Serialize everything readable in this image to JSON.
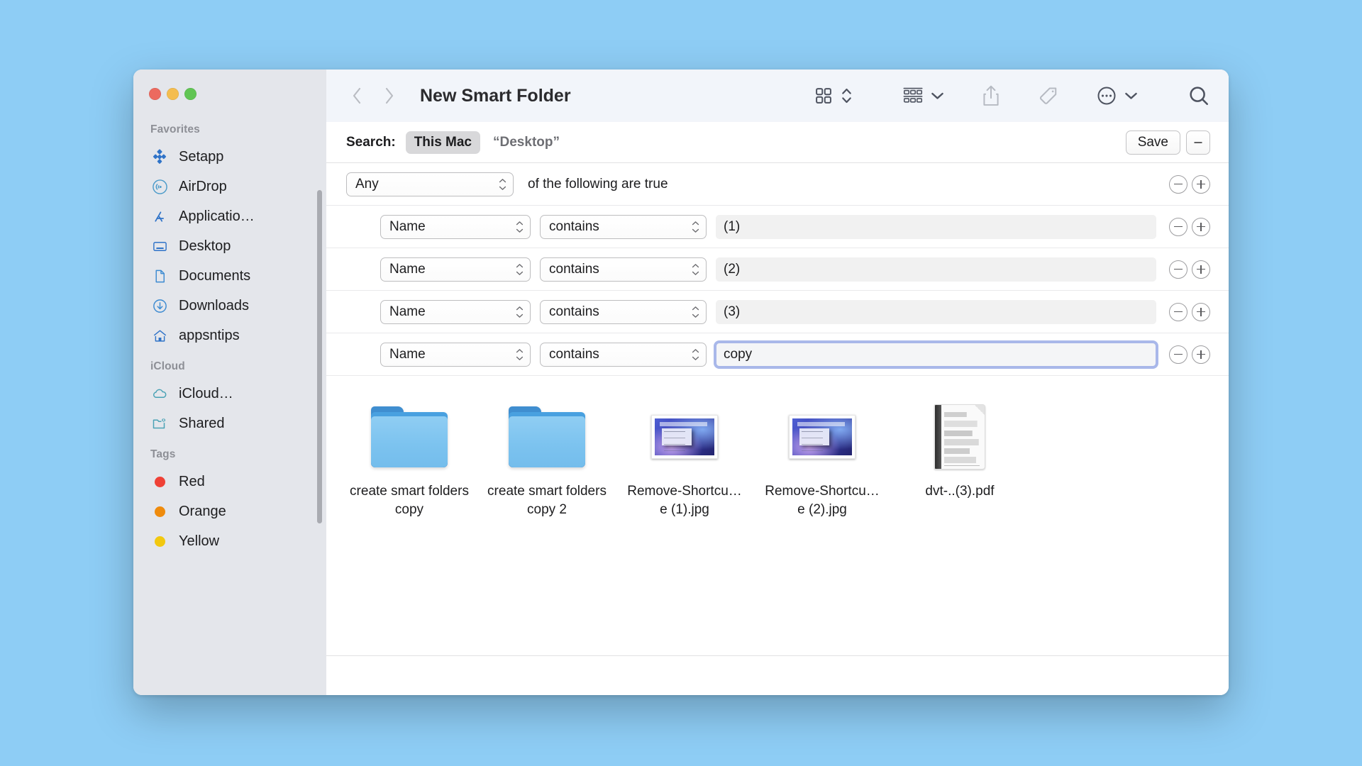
{
  "window": {
    "title": "New Smart Folder",
    "traffic_lights": [
      "close-red",
      "minimize-yellow",
      "maximize-green"
    ]
  },
  "toolbar": {
    "back_icon": "chevron-left-icon",
    "forward_icon": "chevron-right-icon",
    "view_icon": "icon-view-grid-icon",
    "view_stepper_icon": "up-down-chevron-icon",
    "group_icon": "group-by-icon",
    "group_chevron_icon": "chevron-down-icon",
    "share_icon": "share-icon",
    "tag_icon": "tag-icon",
    "more_icon": "more-circle-icon",
    "more_chevron_icon": "chevron-down-icon",
    "search_icon": "search-icon"
  },
  "sidebar": {
    "sections": [
      {
        "title": "Favorites",
        "items": [
          {
            "label": "Setapp",
            "icon": "setapp-icon"
          },
          {
            "label": "AirDrop",
            "icon": "airdrop-icon"
          },
          {
            "label": "Applicatio…",
            "icon": "applications-icon"
          },
          {
            "label": "Desktop",
            "icon": "desktop-icon"
          },
          {
            "label": "Documents",
            "icon": "documents-icon"
          },
          {
            "label": "Downloads",
            "icon": "downloads-icon"
          },
          {
            "label": "appsntips",
            "icon": "home-icon"
          }
        ]
      },
      {
        "title": "iCloud",
        "items": [
          {
            "label": "iCloud…",
            "icon": "icloud-icon"
          },
          {
            "label": "Shared",
            "icon": "shared-folder-icon"
          }
        ]
      },
      {
        "title": "Tags",
        "items": [
          {
            "label": "Red",
            "icon": "tag-dot-icon",
            "color": "#ef4136"
          },
          {
            "label": "Orange",
            "icon": "tag-dot-icon",
            "color": "#ef8b0c"
          },
          {
            "label": "Yellow",
            "icon": "tag-dot-icon",
            "color": "#f2c80f"
          }
        ]
      }
    ]
  },
  "search_header": {
    "label": "Search:",
    "scope_selected": "This Mac",
    "scope_other": "“Desktop”",
    "save_label": "Save",
    "remove_icon": "minus-icon"
  },
  "criteria": {
    "match_value": "Any",
    "match_suffix": "of the following are true",
    "rows": [
      {
        "attribute": "Name",
        "operator": "contains",
        "value": "(1)",
        "focused": false
      },
      {
        "attribute": "Name",
        "operator": "contains",
        "value": "(2)",
        "focused": false
      },
      {
        "attribute": "Name",
        "operator": "contains",
        "value": "(3)",
        "focused": false
      },
      {
        "attribute": "Name",
        "operator": "contains",
        "value": "copy",
        "focused": true
      }
    ],
    "remove_icon": "minus-circle-icon",
    "add_icon": "plus-circle-icon"
  },
  "results": {
    "files": [
      {
        "name": "create smart folders copy",
        "kind": "folder"
      },
      {
        "name": "create smart folders copy 2",
        "kind": "folder"
      },
      {
        "name": "Remove-Shortcu…e (1).jpg",
        "kind": "jpg"
      },
      {
        "name": "Remove-Shortcu…e (2).jpg",
        "kind": "jpg"
      },
      {
        "name": "dvt-..(3).pdf",
        "kind": "pdf"
      }
    ]
  },
  "colors": {
    "desktop": "#8ecdf5",
    "sidebar": "#e4e6eb",
    "toolbar": "#f2f5fa",
    "accent_focus": "#a9b8ea",
    "sidebar_icon_blue": "#3b82cc"
  }
}
